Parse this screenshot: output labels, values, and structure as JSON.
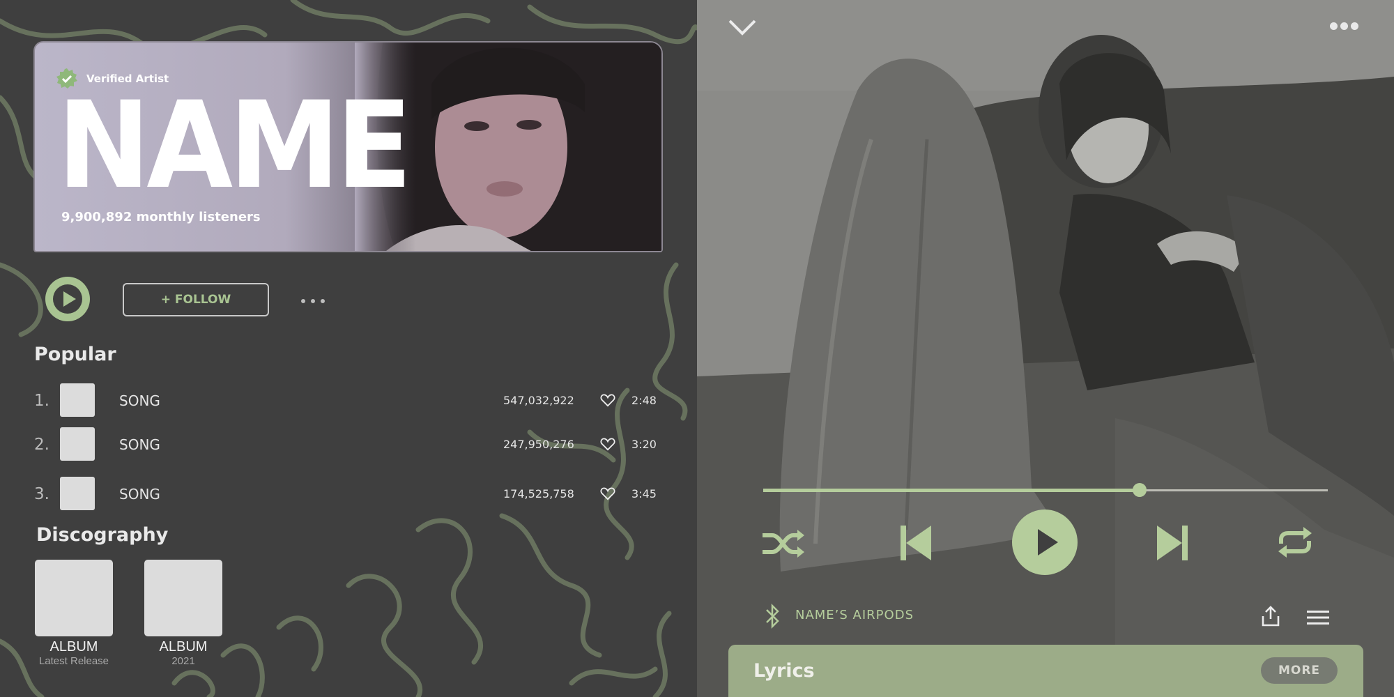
{
  "artist": {
    "verified_label": "Verified Artist",
    "name": "NAME",
    "monthly_listeners": "9,900,892 monthly listeners"
  },
  "actions": {
    "follow_label": "+ FOLLOW"
  },
  "popular": {
    "title": "Popular",
    "songs": [
      {
        "rank": "1.",
        "title": "SONG",
        "plays": "547,032,922",
        "duration": "2:48"
      },
      {
        "rank": "2.",
        "title": "SONG",
        "plays": "247,950,276",
        "duration": "3:20"
      },
      {
        "rank": "3.",
        "title": "SONG",
        "plays": "174,525,758",
        "duration": "3:45"
      }
    ]
  },
  "discography": {
    "title": "Discography",
    "albums": [
      {
        "name": "ALBUM",
        "subtitle": "Latest Release"
      },
      {
        "name": "ALBUM",
        "subtitle": "2021"
      }
    ]
  },
  "player": {
    "progress": 0.667,
    "device": "NAME’S AIRPODS",
    "lyrics_title": "Lyrics",
    "more_label": "MORE"
  },
  "colors": {
    "accent": "#b5cd9c",
    "left_bg": "#3f3f3f",
    "lyrics_bg": "#9cac88"
  }
}
